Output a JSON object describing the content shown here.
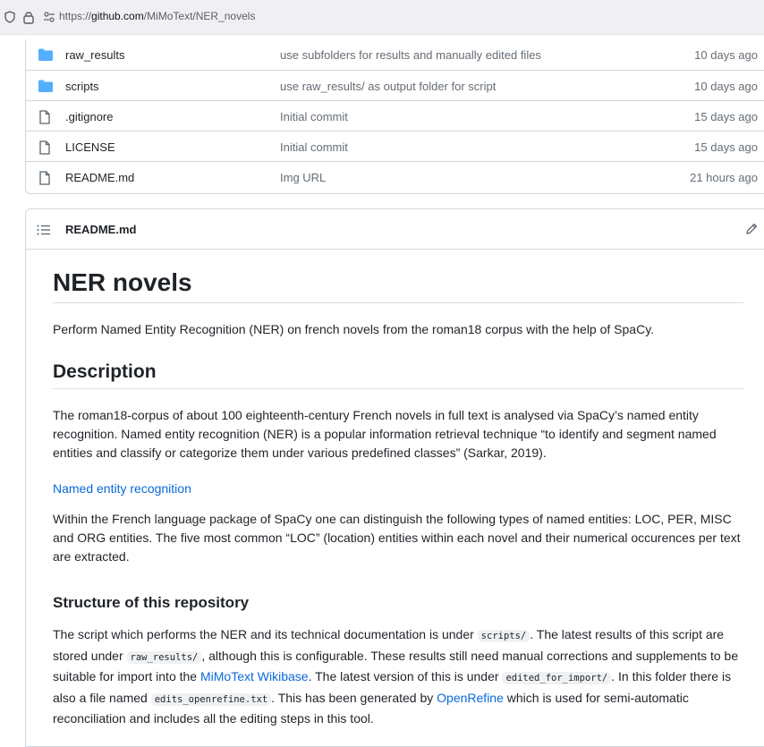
{
  "browser": {
    "url_prefix": "https://",
    "url_host": "github.com",
    "url_path": "/MiMoText/NER_novels"
  },
  "files": [
    {
      "name": "raw_results",
      "type": "folder",
      "commit": "use subfolders for results and manually edited files",
      "date": "10 days ago"
    },
    {
      "name": "scripts",
      "type": "folder",
      "commit": "use raw_results/ as output folder for script",
      "date": "10 days ago"
    },
    {
      "name": ".gitignore",
      "type": "file",
      "commit": "Initial commit",
      "date": "15 days ago"
    },
    {
      "name": "LICENSE",
      "type": "file",
      "commit": "Initial commit",
      "date": "15 days ago"
    },
    {
      "name": "README.md",
      "type": "file",
      "commit": "Img URL",
      "date": "21 hours ago"
    }
  ],
  "readme": {
    "filename": "README.md",
    "title": "NER novels",
    "intro": "Perform Named Entity Recognition (NER) on french novels from the roman18 corpus with the help of SpaCy.",
    "description_heading": "Description",
    "description": "The roman18-corpus of about 100 eighteenth-century French novels in full text is analysed via SpaCy’s named entity recognition. Named entity recognition (NER) is a popular information retrieval technique “to identify and segment named entities and classify or categorize them under various predefined classes” (Sarkar, 2019).",
    "ner_link": "Named entity recognition",
    "entities_text": "Within the French language package of SpaCy one can distinguish the following types of named entities: LOC, PER, MISC and ORG entities. The five most common “LOC” (location) entities within each novel and their numerical occurences per text are extracted.",
    "structure_heading": "Structure of this repository",
    "structure": {
      "t1": "The script which performs the NER and its technical documentation is under ",
      "c1": "scripts/",
      "t2": ". The latest results of this script are stored under ",
      "c2": "raw_results/",
      "t3": ", although this is configurable. These results still need manual corrections and supplements to be suitable for import into the ",
      "l1": "MiMoText Wikibase",
      "t4": ". The latest version of this is under ",
      "c3": "edited_for_import/",
      "t5": ". In this folder there is also a file named ",
      "c4": "edits_openrefine.txt",
      "t6": ". This has been generated by ",
      "l2": "OpenRefine",
      "t7": " which is used for semi-automatic reconciliation and includes all the editing steps in this tool."
    }
  },
  "colors": {
    "link": "#0969da",
    "folder_icon": "#54aeff",
    "muted_text": "#656d76"
  }
}
